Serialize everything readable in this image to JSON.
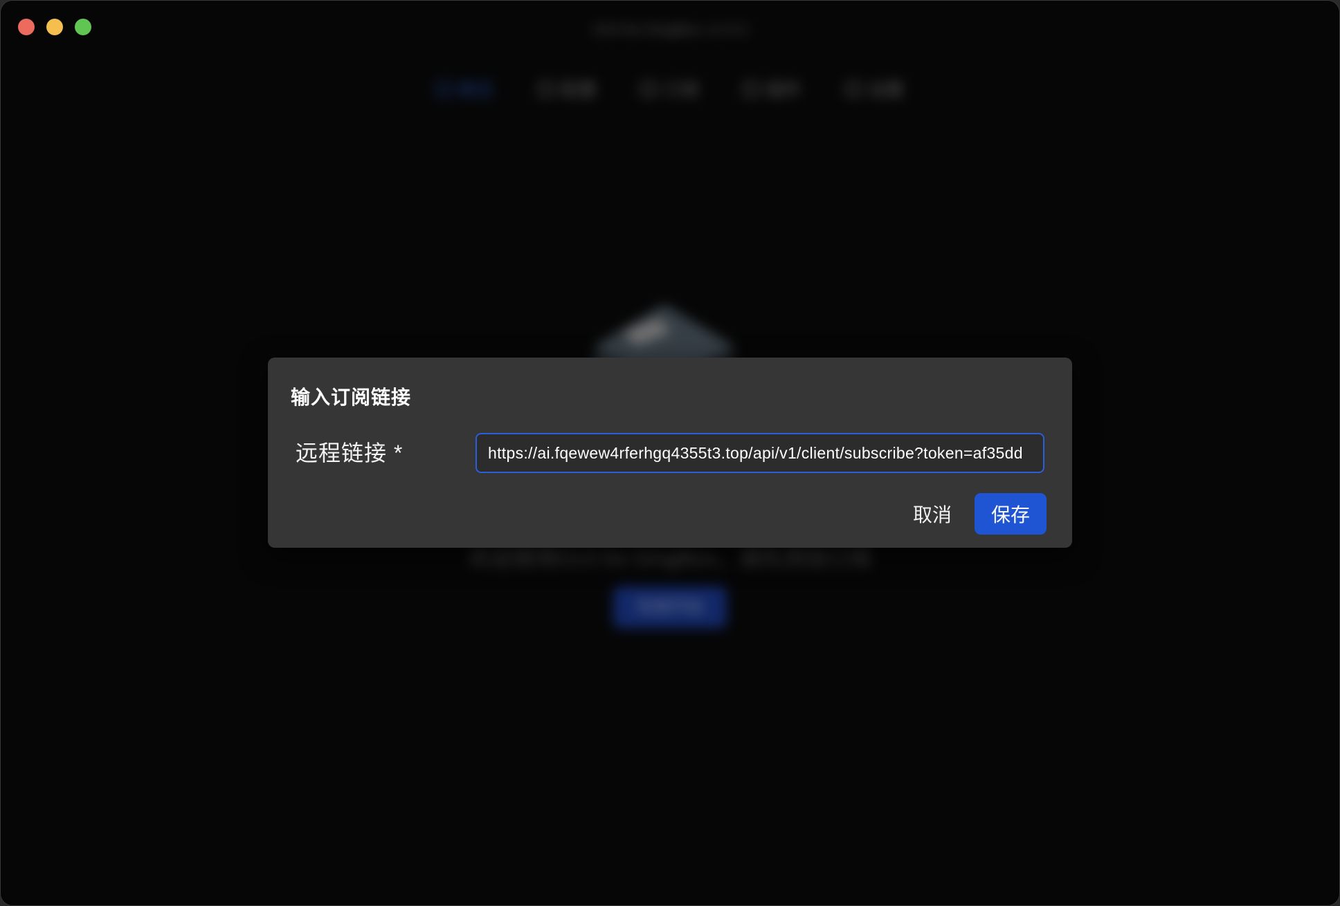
{
  "window": {
    "traffic_lights": [
      "close",
      "minimize",
      "maximize"
    ]
  },
  "background": {
    "title": "GUI.for.SingBox v1.9.3",
    "nav": [
      {
        "label": "概览",
        "active": true,
        "icon": "home-icon"
      },
      {
        "label": "配置",
        "active": false,
        "icon": "profiles-icon"
      },
      {
        "label": "订阅",
        "active": false,
        "icon": "subscriptions-icon"
      },
      {
        "label": "插件",
        "active": false,
        "icon": "plugins-icon"
      },
      {
        "label": "设置",
        "active": false,
        "icon": "settings-icon"
      }
    ],
    "tagline": "欢迎使用GUI.for.SingBox，请先添加订阅",
    "quick_start_label": "快速开始"
  },
  "dialog": {
    "title": "输入订阅链接",
    "field_label": "远程链接 *",
    "url_value": "https://ai.fqewew4rferhgq4355t3.top/api/v1/client/subscribe?token=af35dd",
    "cancel_label": "取消",
    "save_label": "保存"
  },
  "colors": {
    "accent": "#1f55d3",
    "dialog_bg": "#363636",
    "window_bg": "#060606",
    "close_light": "#ec6a5e",
    "minimize_light": "#f4bf4f",
    "maximize_light": "#61c554"
  }
}
